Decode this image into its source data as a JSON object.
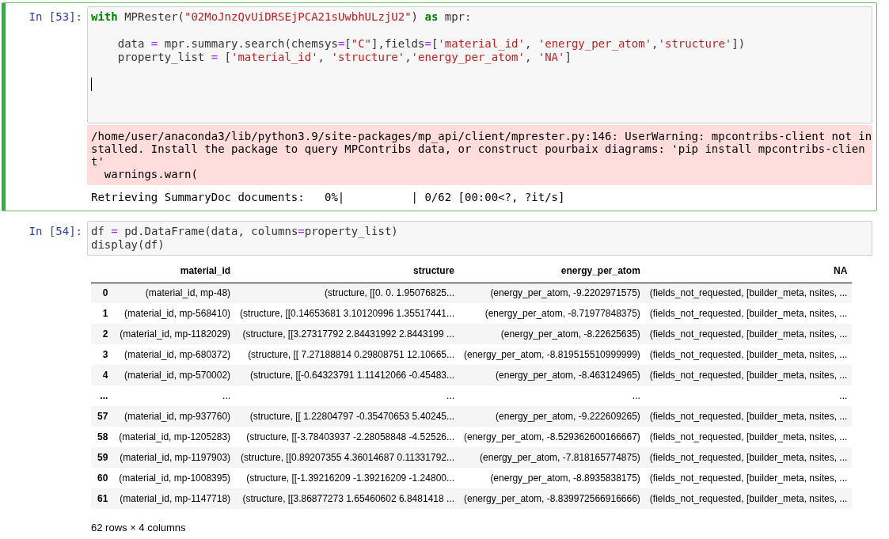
{
  "cells": [
    {
      "prompt": "In [53]:",
      "selected": true,
      "lines": [
        {
          "kind": "code",
          "tokens": [
            {
              "kind": "kw",
              "text": "with"
            },
            {
              "kind": "plain",
              "text": " MPRester("
            },
            {
              "kind": "str",
              "text": "\"02MoJnzQvUiDRSEjPCA21sUwbhULzjU2\""
            },
            {
              "kind": "plain",
              "text": ") "
            },
            {
              "kind": "kw",
              "text": "as"
            },
            {
              "kind": "plain",
              "text": " mpr:"
            }
          ]
        },
        {
          "kind": "blank"
        },
        {
          "kind": "code",
          "tokens": [
            {
              "kind": "plain",
              "text": "    data "
            },
            {
              "kind": "op",
              "text": "="
            },
            {
              "kind": "plain",
              "text": " mpr.summary.search(chemsys"
            },
            {
              "kind": "op",
              "text": "="
            },
            {
              "kind": "plain",
              "text": "["
            },
            {
              "kind": "str",
              "text": "\"C\""
            },
            {
              "kind": "plain",
              "text": "],fields"
            },
            {
              "kind": "op",
              "text": "="
            },
            {
              "kind": "plain",
              "text": "["
            },
            {
              "kind": "str",
              "text": "'material_id'"
            },
            {
              "kind": "plain",
              "text": ", "
            },
            {
              "kind": "str",
              "text": "'energy_per_atom'"
            },
            {
              "kind": "plain",
              "text": ","
            },
            {
              "kind": "str",
              "text": "'structure'"
            },
            {
              "kind": "plain",
              "text": "])"
            }
          ]
        },
        {
          "kind": "code",
          "tokens": [
            {
              "kind": "plain",
              "text": "    property_list "
            },
            {
              "kind": "op",
              "text": "="
            },
            {
              "kind": "plain",
              "text": " ["
            },
            {
              "kind": "str",
              "text": "'material_id'"
            },
            {
              "kind": "plain",
              "text": ", "
            },
            {
              "kind": "str",
              "text": "'structure'"
            },
            {
              "kind": "plain",
              "text": ","
            },
            {
              "kind": "str",
              "text": "'energy_per_atom'"
            },
            {
              "kind": "plain",
              "text": ", "
            },
            {
              "kind": "str",
              "text": "'NA'"
            },
            {
              "kind": "plain",
              "text": "]"
            }
          ]
        },
        {
          "kind": "blank"
        },
        {
          "kind": "cursor"
        }
      ],
      "outputs": [
        {
          "kind": "stderr",
          "text": "/home/user/anaconda3/lib/python3.9/site-packages/mp_api/client/mprester.py:146: UserWarning: mpcontribs-client not installed. Install the package to query MPContribs data, or construct pourbaix diagrams: 'pip install mpcontribs-client'\n  warnings.warn("
        },
        {
          "kind": "stdout",
          "text": "Retrieving SummaryDoc documents:   0%|          | 0/62 [00:00<?, ?it/s]"
        }
      ]
    },
    {
      "prompt": "In [54]:",
      "selected": false,
      "lines": [
        {
          "kind": "code",
          "tokens": [
            {
              "kind": "plain",
              "text": "df "
            },
            {
              "kind": "op",
              "text": "="
            },
            {
              "kind": "plain",
              "text": " pd.DataFrame(data, columns"
            },
            {
              "kind": "op",
              "text": "="
            },
            {
              "kind": "plain",
              "text": "property_list)"
            }
          ]
        },
        {
          "kind": "code",
          "tokens": [
            {
              "kind": "plain",
              "text": "display(df)"
            }
          ]
        }
      ],
      "outputs": [
        {
          "kind": "table",
          "columns": [
            "material_id",
            "structure",
            "energy_per_atom",
            "NA"
          ],
          "rows": [
            {
              "index": "0",
              "cells": [
                "(material_id, mp-48)",
                "(structure, [[0. 0. 1.95076825...",
                "(energy_per_atom, -9.2202971575)",
                "(fields_not_requested, [builder_meta, nsites, ..."
              ]
            },
            {
              "index": "1",
              "cells": [
                "(material_id, mp-568410)",
                "(structure, [[0.14653681 3.10120996 1.35517441...",
                "(energy_per_atom, -8.71977848375)",
                "(fields_not_requested, [builder_meta, nsites, ..."
              ]
            },
            {
              "index": "2",
              "cells": [
                "(material_id, mp-1182029)",
                "(structure, [[3.27317792 2.84431992 2.8443199 ...",
                "(energy_per_atom, -8.22625635)",
                "(fields_not_requested, [builder_meta, nsites, ..."
              ]
            },
            {
              "index": "3",
              "cells": [
                "(material_id, mp-680372)",
                "(structure, [[ 7.27188814 0.29808751 12.10665...",
                "(energy_per_atom, -8.819515510999999)",
                "(fields_not_requested, [builder_meta, nsites, ..."
              ]
            },
            {
              "index": "4",
              "cells": [
                "(material_id, mp-570002)",
                "(structure, [[-0.64323791 1.11412066 -0.45483...",
                "(energy_per_atom, -8.463124965)",
                "(fields_not_requested, [builder_meta, nsites, ..."
              ]
            },
            {
              "index": "...",
              "cells": [
                "...",
                "...",
                "...",
                "..."
              ]
            },
            {
              "index": "57",
              "cells": [
                "(material_id, mp-937760)",
                "(structure, [[ 1.22804797 -0.35470653 5.40245...",
                "(energy_per_atom, -9.222609265)",
                "(fields_not_requested, [builder_meta, nsites, ..."
              ]
            },
            {
              "index": "58",
              "cells": [
                "(material_id, mp-1205283)",
                "(structure, [[-3.78403937 -2.28058848 -4.52526...",
                "(energy_per_atom, -8.529362600166667)",
                "(fields_not_requested, [builder_meta, nsites, ..."
              ]
            },
            {
              "index": "59",
              "cells": [
                "(material_id, mp-1197903)",
                "(structure, [[0.89207355 4.36014687 0.11331792...",
                "(energy_per_atom, -7.818165774875)",
                "(fields_not_requested, [builder_meta, nsites, ..."
              ]
            },
            {
              "index": "60",
              "cells": [
                "(material_id, mp-1008395)",
                "(structure, [[-1.39216209 -1.39216209 -1.24800...",
                "(energy_per_atom, -8.8935838175)",
                "(fields_not_requested, [builder_meta, nsites, ..."
              ]
            },
            {
              "index": "61",
              "cells": [
                "(material_id, mp-1147718)",
                "(structure, [[3.86877273 1.65460602 6.8481418 ...",
                "(energy_per_atom, -8.839972566916666)",
                "(fields_not_requested, [builder_meta, nsites, ..."
              ]
            }
          ],
          "shape": "62 rows × 4 columns"
        }
      ]
    }
  ]
}
